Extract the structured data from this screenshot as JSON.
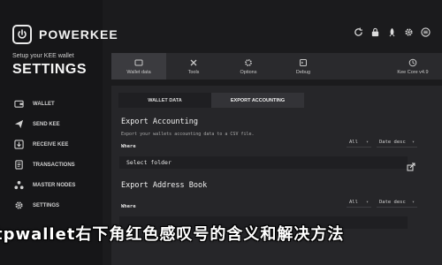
{
  "brand": {
    "name": "POWERKEE",
    "logo_icon": "power-icon"
  },
  "sidebar": {
    "subtitle": "Setup your KEE wallet",
    "section_title": "SETTINGS",
    "items": [
      {
        "label": "WALLET",
        "icon": "wallet-icon"
      },
      {
        "label": "SEND KEE",
        "icon": "send-icon"
      },
      {
        "label": "RECEIVE KEE",
        "icon": "receive-icon"
      },
      {
        "label": "TRANSACTIONS",
        "icon": "transactions-icon"
      },
      {
        "label": "MASTER NODES",
        "icon": "nodes-icon"
      },
      {
        "label": "SETTINGS",
        "icon": "gear-icon"
      }
    ]
  },
  "toolbar": {
    "icons": [
      "sync-icon",
      "lock-icon",
      "rocket-icon",
      "gear-icon",
      "menu-icon"
    ]
  },
  "app_tabs": [
    {
      "label": "Wallet data",
      "icon": "wallet-data-icon",
      "active": true
    },
    {
      "label": "Tools",
      "icon": "tools-icon",
      "active": false
    },
    {
      "label": "Options",
      "icon": "options-icon",
      "active": false
    },
    {
      "label": "Debug",
      "icon": "debug-icon",
      "active": false
    },
    {
      "label": "",
      "icon": "",
      "active": false
    },
    {
      "label": "Kee Core v4.9",
      "icon": "kee-core-icon",
      "active": false
    }
  ],
  "sub_tabs": [
    {
      "label": "WALLET DATA",
      "active": false
    },
    {
      "label": "EXPORT ACCOUNTING",
      "active": true
    }
  ],
  "export_accounting": {
    "title": "Export Accounting",
    "description": "Export your wallets accounting data to a CSV file.",
    "where_label": "Where",
    "filter_all": "All",
    "sort": "Date desc",
    "folder_placeholder": "Select folder"
  },
  "export_address_book": {
    "title": "Export Address Book",
    "where_label": "Where",
    "filter_all": "All",
    "sort": "Date desc"
  },
  "overlay_text": "tpwallet右下角红色感叹号的含义和解决方法",
  "colors": {
    "background": "#1b1b1d",
    "sidebar": "#161618",
    "panel": "#262629",
    "text": "#e6e6e6"
  }
}
